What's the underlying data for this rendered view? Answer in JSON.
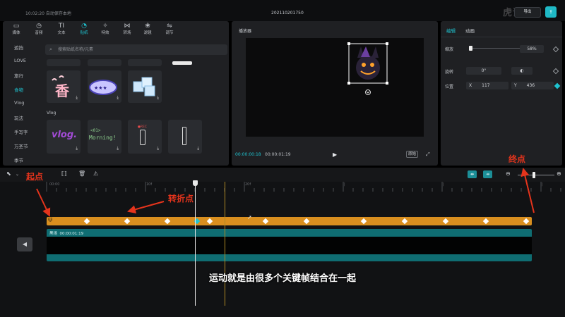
{
  "titlebar": {
    "autosave": "10:02:20 自动保存本地",
    "title": "202110201750",
    "export_label": "导出",
    "watermark": "虎课网"
  },
  "left_panel": {
    "tools": [
      {
        "label": "媒体",
        "icon": "media-icon"
      },
      {
        "label": "音频",
        "icon": "audio-icon"
      },
      {
        "label": "文本",
        "icon": "text-icon"
      },
      {
        "label": "贴纸",
        "icon": "sticker-icon",
        "active": true
      },
      {
        "label": "特效",
        "icon": "effects-icon"
      },
      {
        "label": "转场",
        "icon": "transition-icon"
      },
      {
        "label": "滤镜",
        "icon": "filter-icon"
      },
      {
        "label": "调节",
        "icon": "adjust-icon"
      }
    ],
    "categories": [
      "遮挡",
      "LOVE",
      "旅行",
      "食物",
      "Vlog",
      "玩法",
      "手写字",
      "万圣节",
      "季节"
    ],
    "active_category": "食物",
    "search_placeholder": "搜索贴纸名称/元素",
    "section_vlog": "Vlog",
    "sticker_texts": {
      "vlog": "vlog.",
      "morning_top": "<01>",
      "morning": "Morning!",
      "rec": "●REC"
    }
  },
  "player": {
    "title": "播放器",
    "current_time": "00:00:00:18",
    "total_time": "00:00:01:19",
    "ratio_label": "原始"
  },
  "props": {
    "tabs": [
      "编辑",
      "动画"
    ],
    "scale_label": "缩放",
    "scale_value": "58%",
    "rotate_label": "旋转",
    "rotate_value": "0°",
    "position_label": "位置",
    "x_label": "X",
    "x_value": "117",
    "y_label": "Y",
    "y_value": "436"
  },
  "timeline": {
    "ticks": [
      "00:00",
      "10f",
      "20f"
    ],
    "video_clip_label": "黑场",
    "video_clip_time": "00:00:01:19",
    "zoom_fraction": 0.42
  },
  "annotations": {
    "start": "起点",
    "turn": "转折点",
    "end": "终点"
  },
  "subtitle": "运动就是由很多个关键帧结合在一起"
}
